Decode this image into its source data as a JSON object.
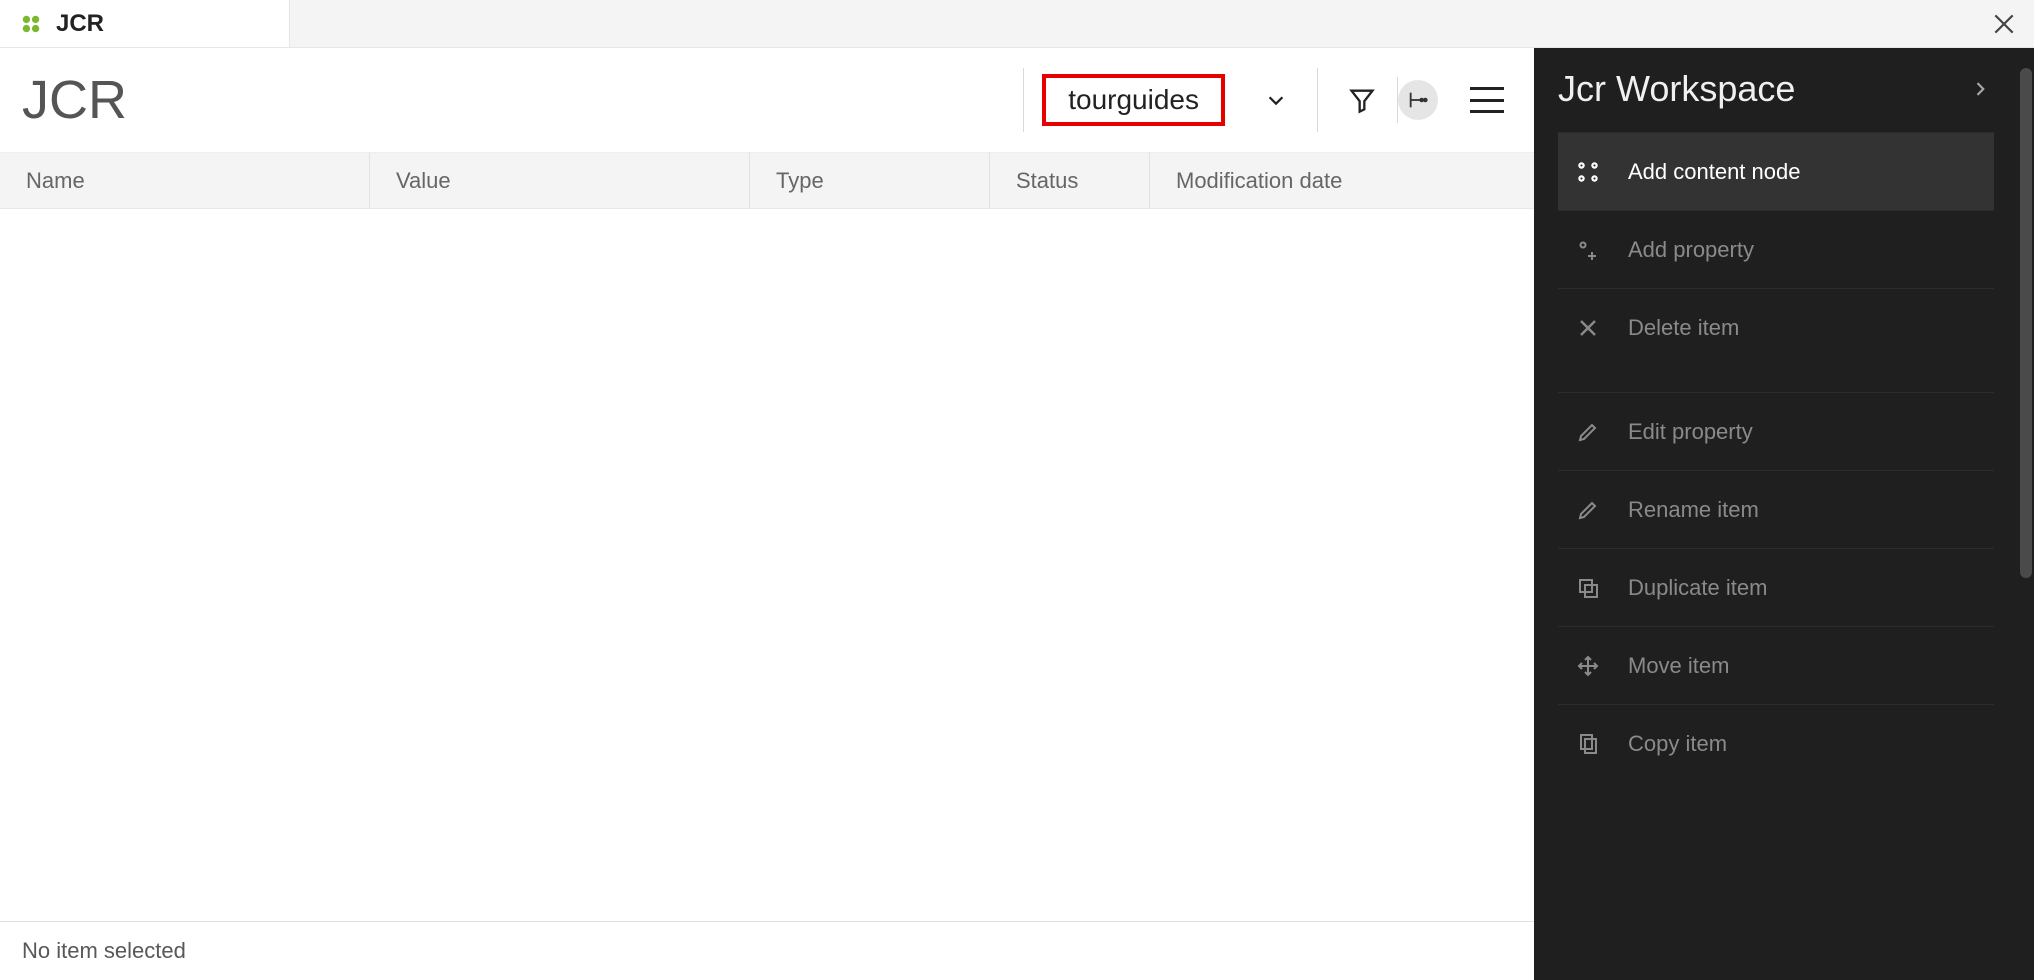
{
  "tab": {
    "title": "JCR"
  },
  "page": {
    "title": "JCR"
  },
  "workspace_selector": {
    "value": "tourguides"
  },
  "columns": {
    "name": "Name",
    "value": "Value",
    "type": "Type",
    "status": "Status",
    "mod": "Modification date"
  },
  "footer": {
    "status": "No item selected"
  },
  "side": {
    "title": "Jcr Workspace",
    "actions": {
      "add_node": "Add content node",
      "add_prop": "Add property",
      "delete": "Delete item",
      "edit_prop": "Edit property",
      "rename": "Rename item",
      "duplicate": "Duplicate item",
      "move": "Move item",
      "copy": "Copy item"
    }
  }
}
